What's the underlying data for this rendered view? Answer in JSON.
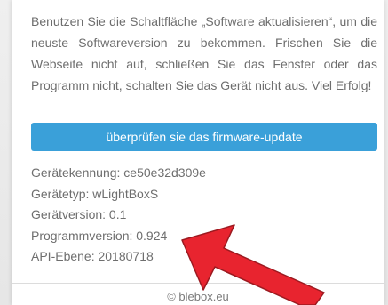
{
  "intro_text": "Benutzen Sie die Schaltfläche „Software aktualisieren“, um die neuste Softwareversion zu bekommen. Frischen Sie die Webseite nicht auf, schließen Sie das Fenster oder das Programm nicht, schalten Sie das Gerät nicht aus. Viel Erfolg!",
  "update_button": {
    "label": "überprüfen sie das firmware-update"
  },
  "device_info": {
    "device_id": "Gerätekennung: ce50e32d309e",
    "device_type": "Gerätetyp: wLightBoxS",
    "device_version": "Gerätversion: 0.1",
    "program_version": "Programmversion: 0.924",
    "api_level": "API-Ebene: 20180718"
  },
  "footer": {
    "text": "© blebox.eu"
  },
  "colors": {
    "button": "#3aa0d9",
    "text": "#6e6e6e",
    "arrow": "#e8242f"
  }
}
